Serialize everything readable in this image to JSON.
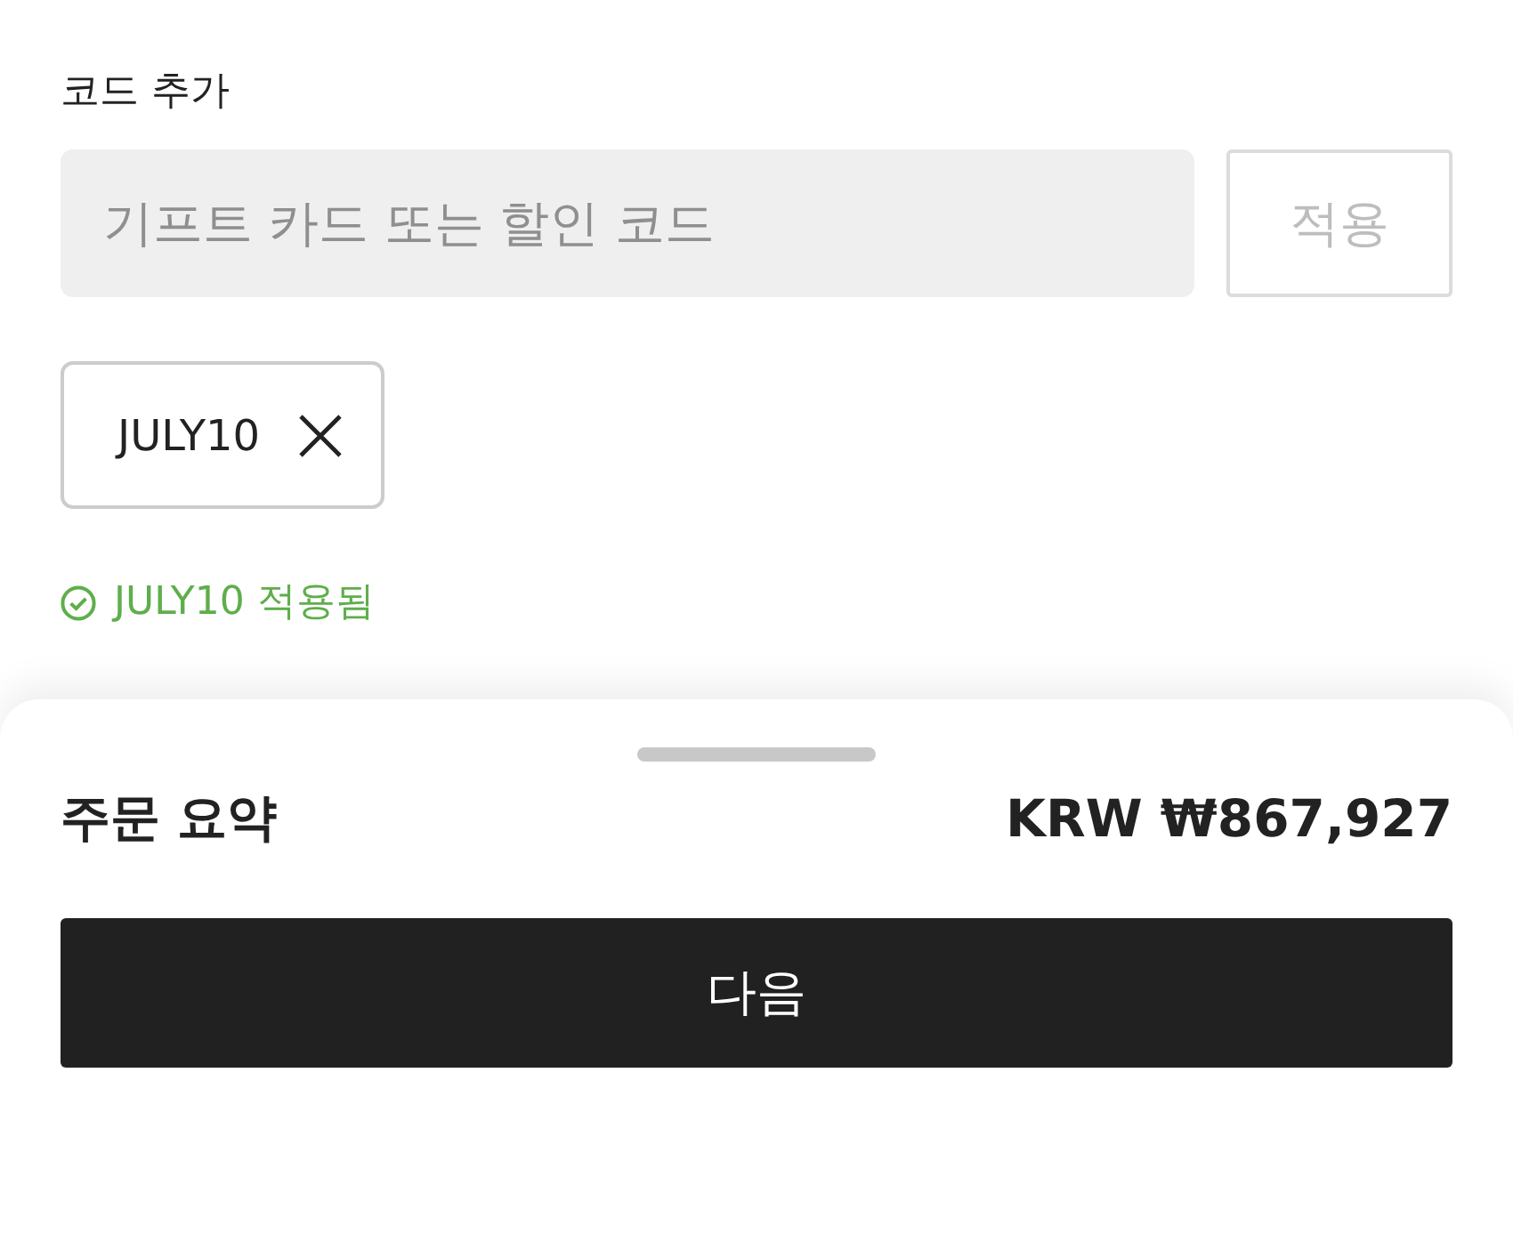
{
  "add_code": {
    "label": "코드 추가",
    "input": {
      "placeholder": "기프트 카드 또는 할인 코드"
    },
    "apply_button": {
      "label": "적용",
      "disabled": true
    }
  },
  "applied_codes": [
    {
      "code": "JULY10"
    }
  ],
  "status_message": {
    "kind": "success",
    "text": "JULY10 적용됨"
  },
  "order_summary": {
    "title": "주문 요약",
    "total": "KRW ₩867,927",
    "next_button": "다음"
  }
}
